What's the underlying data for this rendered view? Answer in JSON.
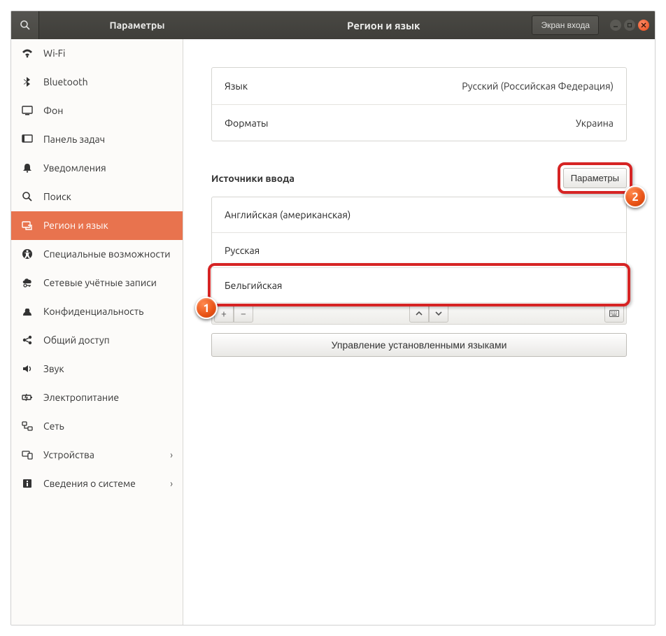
{
  "titlebar": {
    "back_label": "Параметры",
    "title": "Регион и язык",
    "login_screen_btn": "Экран входа"
  },
  "sidebar": {
    "items": [
      {
        "id": "wifi",
        "label": "Wi-Fi"
      },
      {
        "id": "bluetooth",
        "label": "Bluetooth"
      },
      {
        "id": "background",
        "label": "Фон"
      },
      {
        "id": "dock",
        "label": "Панель задач"
      },
      {
        "id": "notifications",
        "label": "Уведомления"
      },
      {
        "id": "search",
        "label": "Поиск"
      },
      {
        "id": "region",
        "label": "Регион и язык",
        "active": true
      },
      {
        "id": "accessibility",
        "label": "Специальные возможности"
      },
      {
        "id": "online-accounts",
        "label": "Сетевые учётные записи"
      },
      {
        "id": "privacy",
        "label": "Конфиденциальность"
      },
      {
        "id": "sharing",
        "label": "Общий доступ"
      },
      {
        "id": "sound",
        "label": "Звук"
      },
      {
        "id": "power",
        "label": "Электропитание"
      },
      {
        "id": "network",
        "label": "Сеть"
      },
      {
        "id": "devices",
        "label": "Устройства",
        "chevron": true
      },
      {
        "id": "about",
        "label": "Сведения о системе",
        "chevron": true
      }
    ]
  },
  "main": {
    "language_row": {
      "label": "Язык",
      "value": "Русский (Российская Федерация)"
    },
    "formats_row": {
      "label": "Форматы",
      "value": "Украина"
    },
    "input_sources_heading": "Источники ввода",
    "options_btn": "Параметры",
    "input_sources": [
      "Английская (американская)",
      "Русская",
      "Бельгийская"
    ],
    "manage_languages_btn": "Управление установленными языками"
  },
  "annotations": {
    "badge1": "1",
    "badge2": "2"
  }
}
